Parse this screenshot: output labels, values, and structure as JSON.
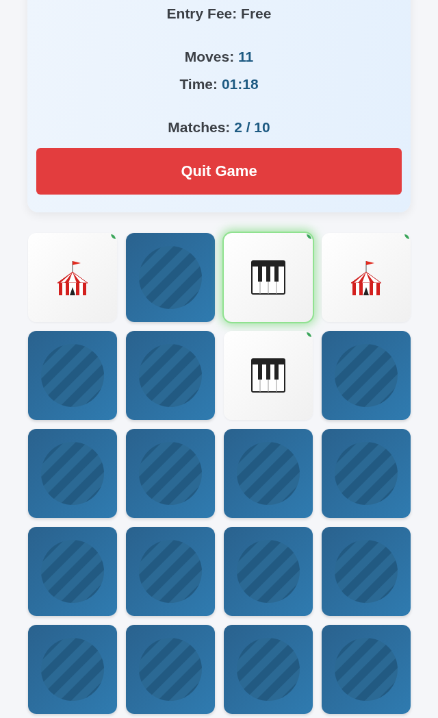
{
  "info": {
    "entry_fee": {
      "label": "Entry Fee:",
      "value": "Free"
    },
    "stats": [
      {
        "label": "Moves:",
        "value": "11"
      },
      {
        "label": "Time:",
        "value": "01:18"
      }
    ],
    "matches": {
      "label": "Matches:",
      "value": "2 / 10"
    }
  },
  "quit_button": "Quit Game",
  "cards": [
    {
      "face_up": true,
      "kind": "circus-tent",
      "matched": true,
      "highlighted": false
    },
    {
      "face_up": false,
      "matched": false,
      "highlighted": false
    },
    {
      "face_up": true,
      "kind": "piano",
      "matched": true,
      "highlighted": true
    },
    {
      "face_up": true,
      "kind": "circus-tent",
      "matched": true,
      "highlighted": false
    },
    {
      "face_up": false,
      "matched": false,
      "highlighted": false
    },
    {
      "face_up": false,
      "matched": false,
      "highlighted": false
    },
    {
      "face_up": true,
      "kind": "piano",
      "matched": true,
      "highlighted": false
    },
    {
      "face_up": false,
      "matched": false,
      "highlighted": false
    },
    {
      "face_up": false,
      "matched": false,
      "highlighted": false
    },
    {
      "face_up": false,
      "matched": false,
      "highlighted": false
    },
    {
      "face_up": false,
      "matched": false,
      "highlighted": false
    },
    {
      "face_up": false,
      "matched": false,
      "highlighted": false
    },
    {
      "face_up": false,
      "matched": false,
      "highlighted": false
    },
    {
      "face_up": false,
      "matched": false,
      "highlighted": false
    },
    {
      "face_up": false,
      "matched": false,
      "highlighted": false
    },
    {
      "face_up": false,
      "matched": false,
      "highlighted": false
    },
    {
      "face_up": false,
      "matched": false,
      "highlighted": false
    },
    {
      "face_up": false,
      "matched": false,
      "highlighted": false
    },
    {
      "face_up": false,
      "matched": false,
      "highlighted": false
    },
    {
      "face_up": false,
      "matched": false,
      "highlighted": false
    }
  ]
}
